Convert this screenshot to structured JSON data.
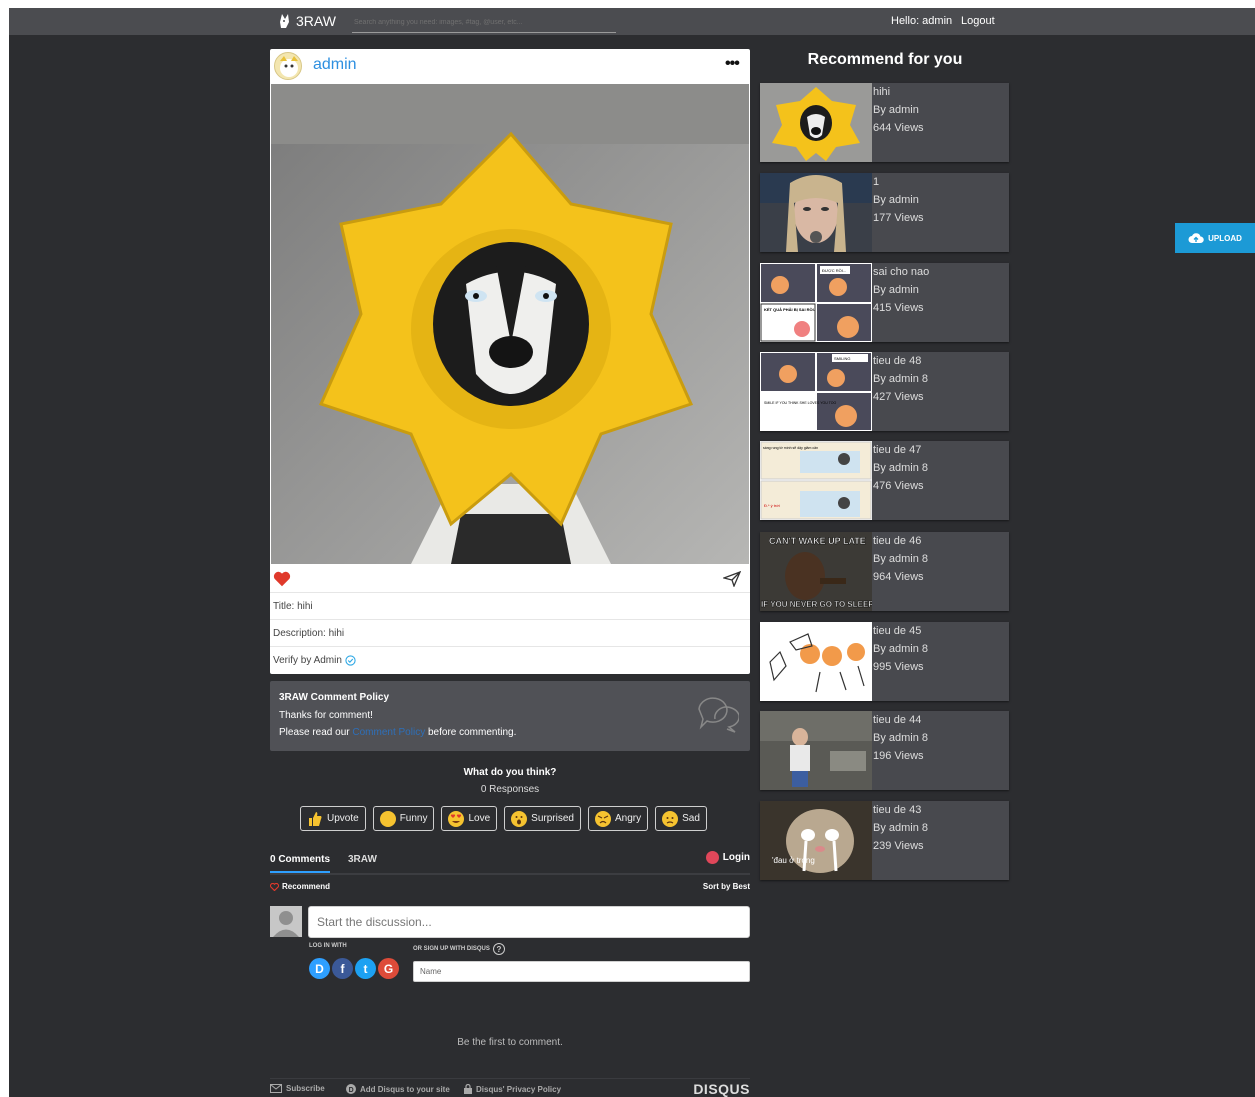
{
  "topbar": {
    "logo_text": "3RAW",
    "search_placeholder": "Search anything you need: images, #tag, @user, etc...",
    "hello": "Hello: admin",
    "logout": "Logout"
  },
  "post": {
    "username": "admin",
    "more": "•••",
    "title_line": "Title: hihi",
    "description_line": "Description: hihi",
    "verify_line": "Verify by Admin"
  },
  "policy": {
    "title": "3RAW Comment Policy",
    "line1": "Thanks for comment!",
    "line2_pre": "Please read our ",
    "line2_link": "Comment Policy",
    "line2_post": " before commenting."
  },
  "disqus": {
    "question": "What do you think?",
    "responses": "0 Responses",
    "reactions": [
      "Upvote",
      "Funny",
      "Love",
      "Surprised",
      "Angry",
      "Sad"
    ],
    "tab_comments": "0 Comments",
    "tab_site": "3RAW",
    "login": "Login",
    "recommend": "Recommend",
    "sort": "Sort by Best",
    "discussion_placeholder": "Start the discussion...",
    "log_in_with": "LOG IN WITH",
    "sign_up": "OR SIGN UP WITH DISQUS",
    "name_placeholder": "Name",
    "first": "Be the first to comment.",
    "footer": {
      "subscribe": "Subscribe",
      "add": "Add Disqus to your site",
      "privacy": "Disqus' Privacy Policy",
      "brand": "DISQUS"
    }
  },
  "recommend": {
    "title": "Recommend for you",
    "items": [
      {
        "title": "hihi",
        "author": "By admin",
        "views": "644 Views"
      },
      {
        "title": "1",
        "author": "By admin",
        "views": "177 Views"
      },
      {
        "title": "sai cho nao",
        "author": "By admin",
        "views": "415 Views"
      },
      {
        "title": "tieu de 48",
        "author": "By admin 8",
        "views": "427 Views"
      },
      {
        "title": "tieu de 47",
        "author": "By admin 8",
        "views": "476 Views"
      },
      {
        "title": "tieu de 46",
        "author": "By admin 8",
        "views": "964 Views"
      },
      {
        "title": "tieu de 45",
        "author": "By admin 8",
        "views": "995 Views"
      },
      {
        "title": "tieu de 44",
        "author": "By admin 8",
        "views": "196 Views"
      },
      {
        "title": "tieu de 43",
        "author": "By admin 8",
        "views": "239 Views"
      }
    ],
    "thumb_texts": {
      "comic3_a": "ĐƯỢC RỒI...",
      "comic3_b": "KẾT QUẢ PHẢI BỊ SAI RỒI.",
      "comic4_a": "SMILING",
      "comic4_b": "SMILE IF YOU THINK SHE LOVES YOU TOO",
      "comic5_a": "sáng rung tớ mình sẽ dậy giảm cân",
      "comic5_b": "Đ.* ý trời",
      "meme_top": "CAN'T WAKE UP LATE",
      "meme_bottom": "IF YOU NEVER GO TO SLEEP",
      "cat_text": "'đau ở trong"
    }
  },
  "upload": "UPLOAD"
}
